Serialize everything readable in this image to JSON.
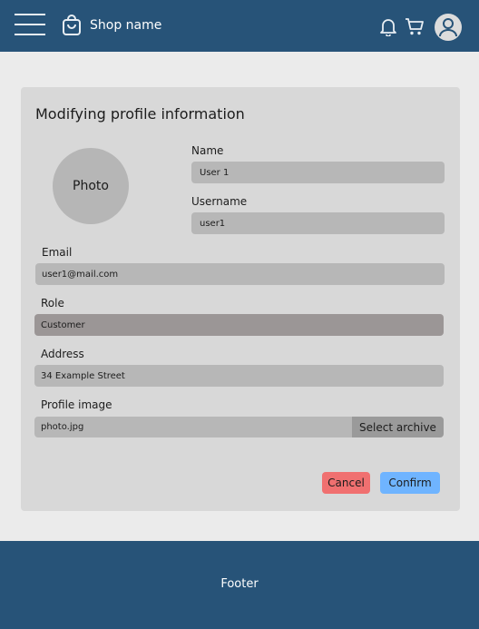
{
  "header": {
    "shop_name": "Shop name",
    "icons": [
      "menu-icon",
      "shopping-bag-icon",
      "bell-icon",
      "cart-icon",
      "user-avatar-icon"
    ]
  },
  "form": {
    "title": "Modifying profile information",
    "photo_label": "Photo",
    "name": {
      "label": "Name",
      "value": "User 1"
    },
    "username": {
      "label": "Username",
      "value": "user1"
    },
    "email": {
      "label": "Email",
      "value": "user1@mail.com"
    },
    "role": {
      "label": "Role",
      "value": "Customer"
    },
    "address": {
      "label": "Address",
      "value": "34 Example Street"
    },
    "profile_image": {
      "label": "Profile image",
      "value": "photo.jpg",
      "button": "Select archive"
    },
    "cancel": "Cancel",
    "confirm": "Confirm"
  },
  "footer": {
    "text": "Footer"
  },
  "colors": {
    "header_bg": "#275378",
    "page_bg": "#ebebeb",
    "card_bg": "#d8d8d8",
    "field_bg": "#b7b7b7",
    "cancel_bg": "#f07070",
    "confirm_bg": "#6fb4ff"
  }
}
